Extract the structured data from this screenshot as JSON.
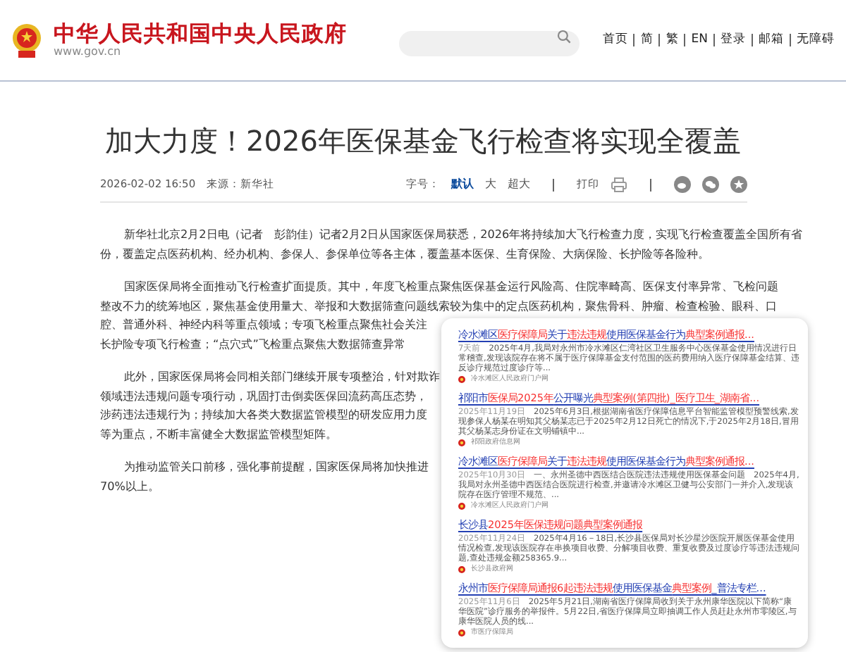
{
  "header": {
    "site_title": "中华人民共和国中央人民政府",
    "site_url": "www.gov.cn",
    "nav": [
      "首页",
      "简",
      "繁",
      "EN",
      "登录",
      "邮箱",
      "无障碍"
    ]
  },
  "article": {
    "title": "加大力度！2026年医保基金飞行检查将实现全覆盖",
    "date": "2026-02-02 16:50",
    "source": "来源：新华社",
    "font_size_label": "字号：",
    "font_sizes": [
      {
        "label": "默认",
        "selected": true
      },
      {
        "label": "大",
        "selected": false
      },
      {
        "label": "超大",
        "selected": false
      }
    ],
    "print_label": "打印",
    "paragraphs": [
      [
        "新华社北京2月2日电（记者　彭韵佳）记者2月2日从国家医保局获悉，2026年将持续加大飞行检查力度，实现飞行检查覆盖全国所有省",
        "份，覆盖定点医药机构、经办机构、参保人、参保单位等各主体，覆盖基本医保、生育保险、大病保险、长护险等各险种。"
      ],
      [
        "国家医保局将全面推动飞行检查扩面提质。其中，年度飞检重点聚焦医保基金运行风险高、住院率畸高、医保支付率异常、飞检问题",
        "整改不力的统筹地区，聚焦基金使用量大、举报和大数据筛查问题线索较为集中的定点医药机构，聚焦骨科、肿瘤、检查检验、眼科、口",
        "腔、普通外科、神经内科等重点领域；专项飞检重点聚焦社会关注",
        "长护险专项飞行检查；“点穴式”飞检重点聚焦大数据筛查异常"
      ],
      [
        "此外，国家医保局将会同相关部门继续开展专项整治，针对欺诈",
        "领域违法违规问题专项行动，巩固打击倒卖医保回流药高压态势，",
        "涉药违法违规行为；持续加大各类大数据监管模型的研发应用力度",
        "等为重点，不断丰富健全大数据监管模型矩阵。"
      ],
      [
        "为推动监管关口前移，强化事前提醒，国家医保局将加快推进",
        "70%以上。"
      ]
    ]
  },
  "search_popup": {
    "results": [
      {
        "title": [
          {
            "text": "冷水滩区",
            "highlight": false
          },
          {
            "text": "医疗保障局",
            "highlight": true
          },
          {
            "text": "关于",
            "highlight": false
          },
          {
            "text": "违法违规",
            "highlight": true
          },
          {
            "text": "使用医保基金行为",
            "highlight": false
          },
          {
            "text": "典型案例通报...",
            "highlight": true
          }
        ],
        "date": "7天前",
        "snippet": "2025年4月,我局对永州市冷水滩区仁湾社区卫生服务中心医保基金使用情况进行日常稽查,发现该院存在将不属于医疗保障基金支付范围的医药费用纳入医疗保障基金结算、违反诊疗规范过度诊疗等...",
        "source": "冷水滩区人民政府门户网"
      },
      {
        "title": [
          {
            "text": "祁阳市",
            "highlight": false
          },
          {
            "text": "医保局",
            "highlight": true
          },
          {
            "text": "2025年",
            "highlight": true
          },
          {
            "text": "公开曝光",
            "highlight": false
          },
          {
            "text": "典型案例(第四批)_医疗卫生_湖南省...",
            "highlight": true
          }
        ],
        "date": "2025年11月19日",
        "snippet": "2025年6月3日,根据湖南省医疗保障信息平台智能监管模型预警线索,发现参保人杨某在明知其父杨某志已于2025年2月12日死亡的情况下,于2025年2月18日,冒用其父杨某志身份证在文明铺镇中...",
        "source": "祁阳政府信息网"
      },
      {
        "title": [
          {
            "text": "冷水滩区",
            "highlight": false
          },
          {
            "text": "医疗保障局",
            "highlight": true
          },
          {
            "text": "关于",
            "highlight": false
          },
          {
            "text": "违法违规",
            "highlight": true
          },
          {
            "text": "使用医保基金行为",
            "highlight": false
          },
          {
            "text": "典型案例通报...",
            "highlight": true
          }
        ],
        "date": "2025年10月30日",
        "snippet": "一、永州圣德中西医结合医院违法违规使用医保基金问题　2025年4月,我局对永州圣德中西医结合医院进行检查,并邀请冷水滩区卫健与公安部门一并介入,发现该院存在医疗管理不规范、...",
        "source": "冷水滩区人民政府门户网"
      },
      {
        "title": [
          {
            "text": "长沙县",
            "highlight": false
          },
          {
            "text": "2025年医保违规问题",
            "highlight": true
          },
          {
            "text": "典型案例通报",
            "highlight": true
          }
        ],
        "date": "2025年11月24日",
        "snippet": "2025年4月16－18日,长沙县医保局对长沙星沙医院开展医保基金使用情况检查,发现该医院存在串换项目收费、分解项目收费、重复收费及过度诊疗等违法违规问题,查处违规金额258365.9...",
        "source": "长沙县政府网"
      },
      {
        "title": [
          {
            "text": "永州市",
            "highlight": false
          },
          {
            "text": "医疗保障局通报6起违法违规",
            "highlight": true
          },
          {
            "text": "使用医保基金",
            "highlight": false
          },
          {
            "text": "典型案例",
            "highlight": true
          },
          {
            "text": "_普法专栏...",
            "highlight": false
          }
        ],
        "date": "2025年11月6日",
        "snippet": "2025年5月21日,湖南省医疗保障局收到关于永州康华医院以下简称“康华医院”诊疗服务的举报件。5月22日,省医疗保障局立即抽调工作人员赶赴永州市零陵区,与康华医院人员的线...",
        "source": "市医疗保障局"
      }
    ]
  }
}
